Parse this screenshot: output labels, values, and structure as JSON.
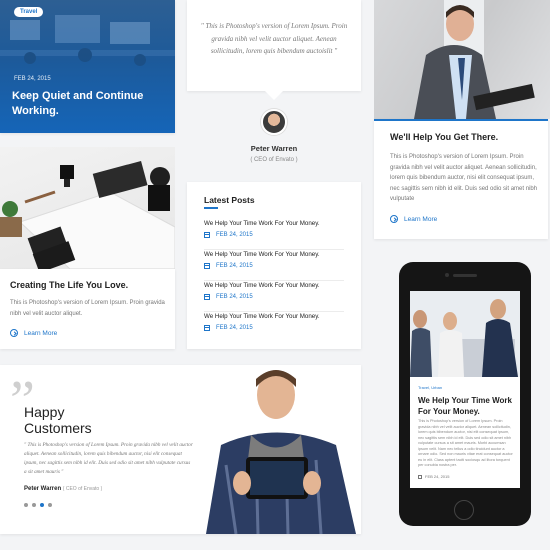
{
  "travel_card": {
    "tag": "Travel",
    "date": "FEB 24, 2015",
    "title": "Keep Quiet and Continue Working."
  },
  "testimonial": {
    "quote": "\" This is Photoshop's version of Lorem Ipsum. Proin gravida nibh vel velit auctor aliquet. Aenean sollicitudin, lorem quis bibendum auctoislit \"",
    "name": "Peter Warren",
    "role": "( CEO of Envato )"
  },
  "help_card": {
    "title": "We'll Help You Get There.",
    "body": "This is Photoshop's version of Lorem Ipsum. Proin gravida nibh vel velit auctor aliquet. Aenean sollicitudin, lorem quis bibendum auctor, nisi elit consequat ipsum, nec sagittis sem nibh id elit. Duis sed odio sit amet nibh vulputate",
    "link": "Learn More"
  },
  "creating_card": {
    "title": "Creating The Life You Love.",
    "body": "This is Photoshop's version of Lorem Ipsum. Proin gravida nibh vel velit auctor aliquet.",
    "link": "Learn More"
  },
  "latest_posts": {
    "title": "Latest Posts",
    "items": [
      {
        "title": "We Help Your Time Work For Your Money.",
        "date": "FEB 24, 2015"
      },
      {
        "title": "We Help Your Time Work For Your Money.",
        "date": "FEB 24, 2015"
      },
      {
        "title": "We Help Your Time Work For Your Money.",
        "date": "FEB 24, 2015"
      },
      {
        "title": "We Help Your Time Work For Your Money.",
        "date": "FEB 24, 2015"
      }
    ]
  },
  "happy_customers": {
    "title_line1": "Happy",
    "title_line2": "Customers",
    "quote": "\" This is Photoshop's version of Lorem Ipsum. Proin gravida nibh vel velit auctor aliquet. Aenean sollicitudin, lorem quis bibendum auctor, nisi elit consequat ipsum, nec sagittis sem nibh id elit. Duis sed odio sit amet nibh vulputate cursus a sit amet mauris \"",
    "author": "Peter Warren",
    "author_role": "( CEO of Envato )"
  },
  "phone": {
    "tag": "Travel, Urban",
    "title": "We Help Your Time Work For Your Money.",
    "body": "This is Photoshop's version of Lorem Ipsum. Proin gravida nibh vel velit auctor aliquet. Aenean sollicitudin, lorem quis bibendum auctor, nisi elit consequat ipsum, nec sagittis sem nibh id elit. Duis sed odio sit amet nibh vulputate cursus a sit amet mauris. Morbi accumsan ipsum velit. Nam nec tellus a odio tincidunt auctor a ornare odio. Sed non mauris vitae erat consequat auctor eu in elit. Class aptent taciti sociosqu ad litora torquent per conubia nostra per.",
    "date": "FEB 24, 2015"
  },
  "colors": {
    "accent": "#1e75c9"
  }
}
